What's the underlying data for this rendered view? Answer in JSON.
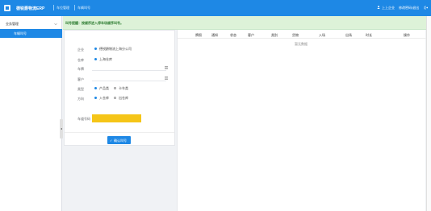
{
  "topbar": {
    "app_title": "德锐爵物流ERP",
    "crumb1": "车位管理",
    "crumb2": "车辆叫号",
    "user_name": "上上企业",
    "user_action": "修改密码/退出",
    "bg_color": "#1e88e5"
  },
  "sidebar": {
    "group_label": "业务管理",
    "active_item": "车辆叫号",
    "collapse_glyph": "◂"
  },
  "notice": {
    "text": "叫号提醒：按顺序进入停车场顺序叫号。"
  },
  "form": {
    "fields": [
      {
        "label": "企业",
        "option": "德锐爵物流上海分公司"
      },
      {
        "label": "仓库",
        "option": "上海仓库"
      },
      {
        "label": "车牌",
        "value": ""
      },
      {
        "label": "客户",
        "value": ""
      },
      {
        "label": "类型",
        "opt1": "产品类",
        "opt2": "卡车类"
      },
      {
        "label": "方向",
        "opt1": "入仓库",
        "opt2": "出仓库"
      },
      {
        "label": "车道号码",
        "value": ""
      }
    ],
    "submit_label": "确认叫号"
  },
  "table": {
    "columns": [
      "牌照",
      "通知",
      "状态",
      "客户",
      "类别",
      "货物",
      "入场",
      "出场",
      "时长",
      "操作"
    ],
    "empty_text": "暂无数据"
  }
}
